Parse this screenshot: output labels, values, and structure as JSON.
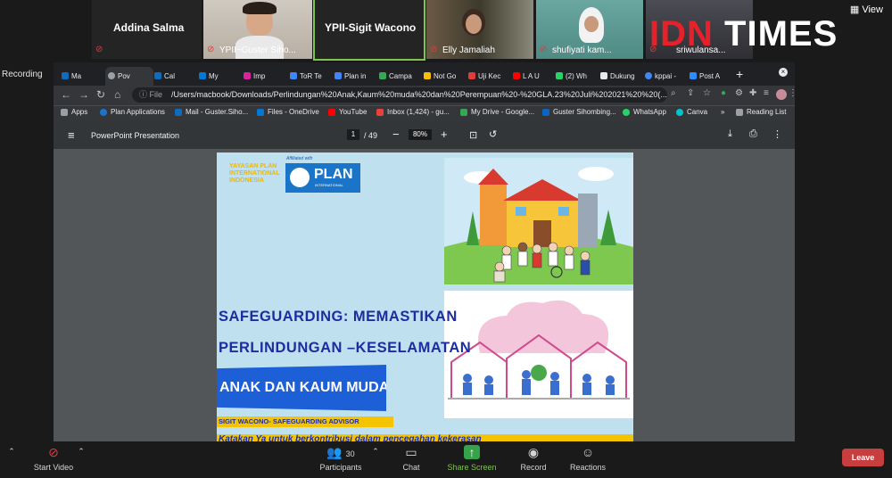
{
  "participants": [
    {
      "name": "Addina Salma",
      "label": ""
    },
    {
      "name": "",
      "label": "YPII~Guster Siho..."
    },
    {
      "name": "YPII-Sigit Wacono",
      "label": ""
    },
    {
      "name": "",
      "label": "Elly Jamaliah"
    },
    {
      "name": "",
      "label": "shufiyati kam..."
    },
    {
      "name": "",
      "label": "sriwulansa..."
    }
  ],
  "view_label": "View",
  "watermark": {
    "idn": "IDN",
    "times": "TIMES"
  },
  "recording_label": "Recording",
  "browser": {
    "tabs": [
      "Ma",
      "Pov",
      "Cal",
      "My",
      "Imp",
      "ToR Te",
      "Plan in",
      "Campa",
      "Not Go",
      "Uji Kec",
      "L A U",
      "(2) Wh",
      "Dukung",
      "kppai -",
      "Post A"
    ],
    "url_prefix": "File",
    "url": "/Users/macbook/Downloads/Perlindungan%20Anak,Kaum%20muda%20dan%20Perempuan%20-%20GLA.23%20Juli%202021%20%20(...",
    "bookmarks": [
      "Apps",
      "Plan Applications",
      "Mail - Guster.Siho...",
      "Files - OneDrive",
      "YouTube",
      "Inbox (1,424) - gu...",
      "My Drive - Google...",
      "Guster Sihombing...",
      "WhatsApp",
      "Canva",
      "Reading List"
    ],
    "pdf_title": "PowerPoint Presentation",
    "page_current": "1",
    "page_total": "/ 49",
    "zoom": "80%"
  },
  "slide": {
    "yayasan": "YAYASAN PLAN INTERNATIONAL INDONESIA",
    "affiliated": "Affiliated with",
    "plan_logo": "PLAN",
    "plan_sub": "INTERNATIONAL",
    "title_line1": "SAFEGUARDING: MEMASTIKAN",
    "title_line2": "PERLINDUNGAN –KESELAMATAN",
    "title_line3": "ANAK DAN KAUM MUDA",
    "presenter": "SIGIT WACONO- SAFEGUARDING ADVISOR",
    "tagline": "Katakan Ya untuk berkontribusi dalam pencegahan kekerasan"
  },
  "toolbar": {
    "start_video": "Start Video",
    "participants": "Participants",
    "participant_count": "30",
    "chat": "Chat",
    "share_screen": "Share Screen",
    "record": "Record",
    "reactions": "Reactions",
    "leave": "Leave"
  }
}
